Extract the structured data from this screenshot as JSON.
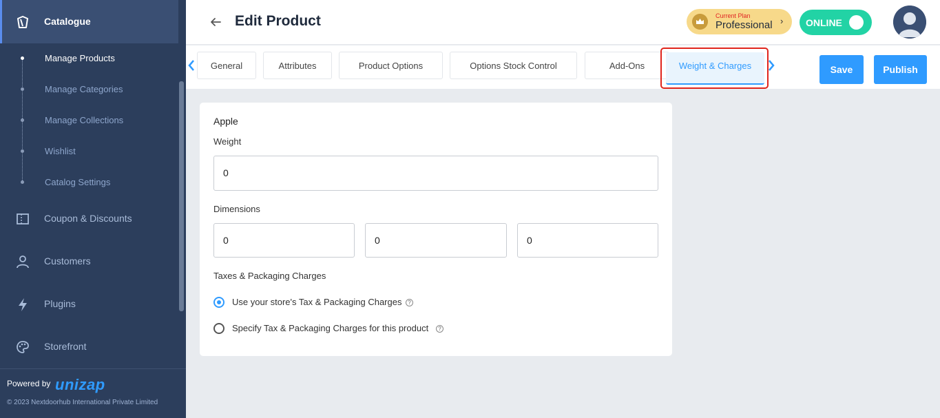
{
  "sidebar": {
    "section_title": "Catalogue",
    "sub_items": [
      {
        "label": "Manage Products"
      },
      {
        "label": "Manage Categories"
      },
      {
        "label": "Manage Collections"
      },
      {
        "label": "Wishlist"
      },
      {
        "label": "Catalog Settings"
      }
    ],
    "nav_items": [
      {
        "label": "Coupon & Discounts",
        "icon": "ticket-icon"
      },
      {
        "label": "Customers",
        "icon": "user-icon"
      },
      {
        "label": "Plugins",
        "icon": "lightning-icon"
      },
      {
        "label": "Storefront",
        "icon": "palette-icon"
      }
    ],
    "footer": {
      "powered_by": "Powered by",
      "brand": "unizap",
      "copyright": "© 2023 Nextdoorhub International Private Limited"
    }
  },
  "header": {
    "title": "Edit Product",
    "plan_small": "Current Plan",
    "plan_name": "Professional",
    "plan_chevron": "›",
    "status": "ONLINE"
  },
  "tabs": [
    {
      "label": "General"
    },
    {
      "label": "Attributes"
    },
    {
      "label": "Product Options"
    },
    {
      "label": "Options Stock Control"
    },
    {
      "label": "Add-Ons"
    },
    {
      "label": "Weight & Charges"
    }
  ],
  "actions": {
    "save": "Save",
    "publish": "Publish"
  },
  "form": {
    "product_name": "Apple",
    "weight_label": "Weight",
    "weight_value": "0",
    "dimensions_label": "Dimensions",
    "dimensions": [
      "0",
      "0",
      "0"
    ],
    "taxes_label": "Taxes & Packaging Charges",
    "options": [
      {
        "label": "Use your store's Tax & Packaging Charges",
        "checked": true
      },
      {
        "label": "Specify Tax & Packaging Charges for this product",
        "checked": false
      }
    ],
    "help_glyph": "?"
  },
  "colors": {
    "accent": "#2f9bff",
    "sidebar": "#2c3e5c",
    "online": "#22d3a5",
    "highlight": "#e0241b"
  }
}
